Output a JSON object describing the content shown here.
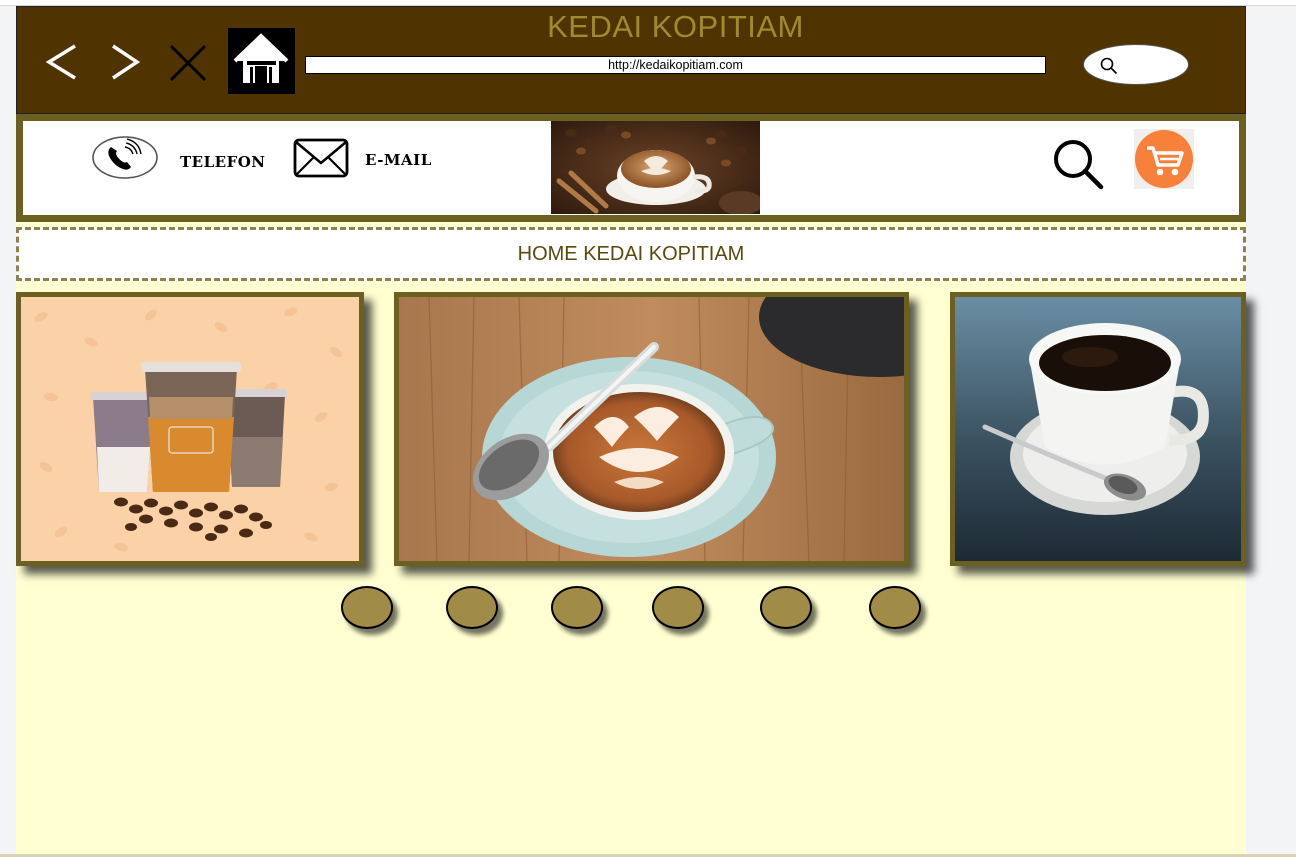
{
  "browser": {
    "title": "KEDAI KOPITIAM",
    "url": "http://kedaikopitiam.com",
    "icons": {
      "back": "chevron-left-icon",
      "forward": "chevron-right-icon",
      "close": "close-icon",
      "home": "home-icon",
      "search": "search-icon"
    }
  },
  "header": {
    "phone_label": "TELEFON",
    "email_label": "E-MAIL",
    "icons": {
      "phone": "phone-icon",
      "email": "envelope-icon",
      "search": "search-icon",
      "cart": "shopping-cart-icon"
    }
  },
  "breadcrumb": {
    "text": "HOME KEDAI KOPITIAM"
  },
  "carousel": {
    "dot_count": 6,
    "colors": {
      "frame": "#6b5f22",
      "dot": "#a08c46",
      "background": "#ffffd2",
      "header_bar": "#4f3300",
      "title": "#a08a2e",
      "cart": "#f7803a"
    }
  }
}
